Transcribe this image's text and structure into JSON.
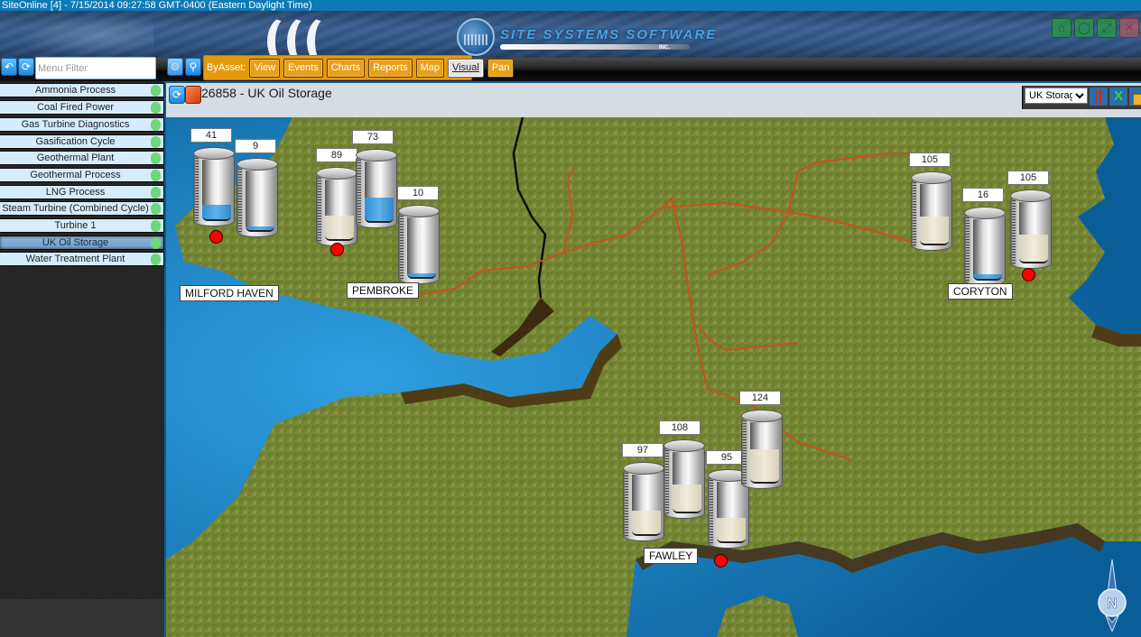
{
  "window": {
    "title": "SiteOnline [4] - 7/15/2014 09:27:58 GMT-0400 (Eastern Daylight Time)"
  },
  "banner": {
    "company_name": "SITE SYSTEMS SOFTWARE",
    "company_suffix": "INC.",
    "window_controls": [
      {
        "name": "home",
        "icon": "home-icon"
      },
      {
        "name": "status",
        "icon": "circle-icon"
      },
      {
        "name": "maximize",
        "icon": "expand-icon"
      },
      {
        "name": "close",
        "icon": "close-icon"
      }
    ]
  },
  "toolbar": {
    "back_icon": "undo-icon",
    "refresh_icon": "refresh-icon",
    "menu_filter_placeholder": "Menu Filter",
    "menu_filter_value": "",
    "settings_icon": "gear-icon",
    "search_icon": "magnifier-icon",
    "by_asset_label": "ByAsset:",
    "nav_buttons": [
      {
        "label": "View",
        "active": false
      },
      {
        "label": "Events",
        "active": false
      },
      {
        "label": "Charts",
        "active": false
      },
      {
        "label": "Reports",
        "active": false
      },
      {
        "label": "Map",
        "active": false
      },
      {
        "label": "Visual",
        "active": true
      },
      {
        "label": "Pan",
        "active": false
      }
    ]
  },
  "sidebar": {
    "items": [
      {
        "label": "Ammonia Process",
        "status": "ok",
        "active": false
      },
      {
        "label": "Coal Fired Power",
        "status": "ok",
        "active": false
      },
      {
        "label": "Gas Turbine Diagnostics",
        "status": "ok",
        "active": false
      },
      {
        "label": "Gasification Cycle",
        "status": "ok",
        "active": false
      },
      {
        "label": "Geothermal Plant",
        "status": "ok",
        "active": false
      },
      {
        "label": "Geothermal Process",
        "status": "ok",
        "active": false
      },
      {
        "label": "LNG Process",
        "status": "ok",
        "active": false
      },
      {
        "label": "Steam Turbine (Combined Cycle)",
        "status": "ok",
        "active": false
      },
      {
        "label": "Turbine 1",
        "status": "ok",
        "active": false
      },
      {
        "label": "UK Oil Storage",
        "status": "ok",
        "active": true
      },
      {
        "label": "Water Treatment Plant",
        "status": "ok",
        "active": false
      }
    ],
    "status_color": "#6fd77a"
  },
  "content": {
    "title": "26858 - UK Oil Storage",
    "view_select": {
      "selected": "UK Storage"
    },
    "tools": [
      "pause-icon",
      "excel-export-icon",
      "package-icon"
    ]
  },
  "map": {
    "compass_label": "N",
    "sites": [
      {
        "name": "MILFORD HAVEN",
        "tanks": [
          {
            "value": "41",
            "fill_fraction": 0.25,
            "product": "water"
          },
          {
            "value": "9",
            "fill_fraction": 0.06,
            "product": "water"
          }
        ]
      },
      {
        "name": "PEMBROKE",
        "tanks": [
          {
            "value": "89",
            "fill_fraction": 0.4,
            "product": "oil"
          },
          {
            "value": "73",
            "fill_fraction": 0.4,
            "product": "water"
          },
          {
            "value": "10",
            "fill_fraction": 0.06,
            "product": "water"
          }
        ]
      },
      {
        "name": "CORYTON",
        "tanks": [
          {
            "value": "105",
            "fill_fraction": 0.45,
            "product": "oil"
          },
          {
            "value": "16",
            "fill_fraction": 0.08,
            "product": "water"
          },
          {
            "value": "105",
            "fill_fraction": 0.45,
            "product": "oil"
          }
        ]
      },
      {
        "name": "FAWLEY",
        "tanks": [
          {
            "value": "97",
            "fill_fraction": 0.4,
            "product": "oil"
          },
          {
            "value": "108",
            "fill_fraction": 0.45,
            "product": "oil"
          },
          {
            "value": "95",
            "fill_fraction": 0.4,
            "product": "oil"
          },
          {
            "value": "124",
            "fill_fraction": 0.55,
            "product": "oil"
          }
        ]
      }
    ]
  }
}
